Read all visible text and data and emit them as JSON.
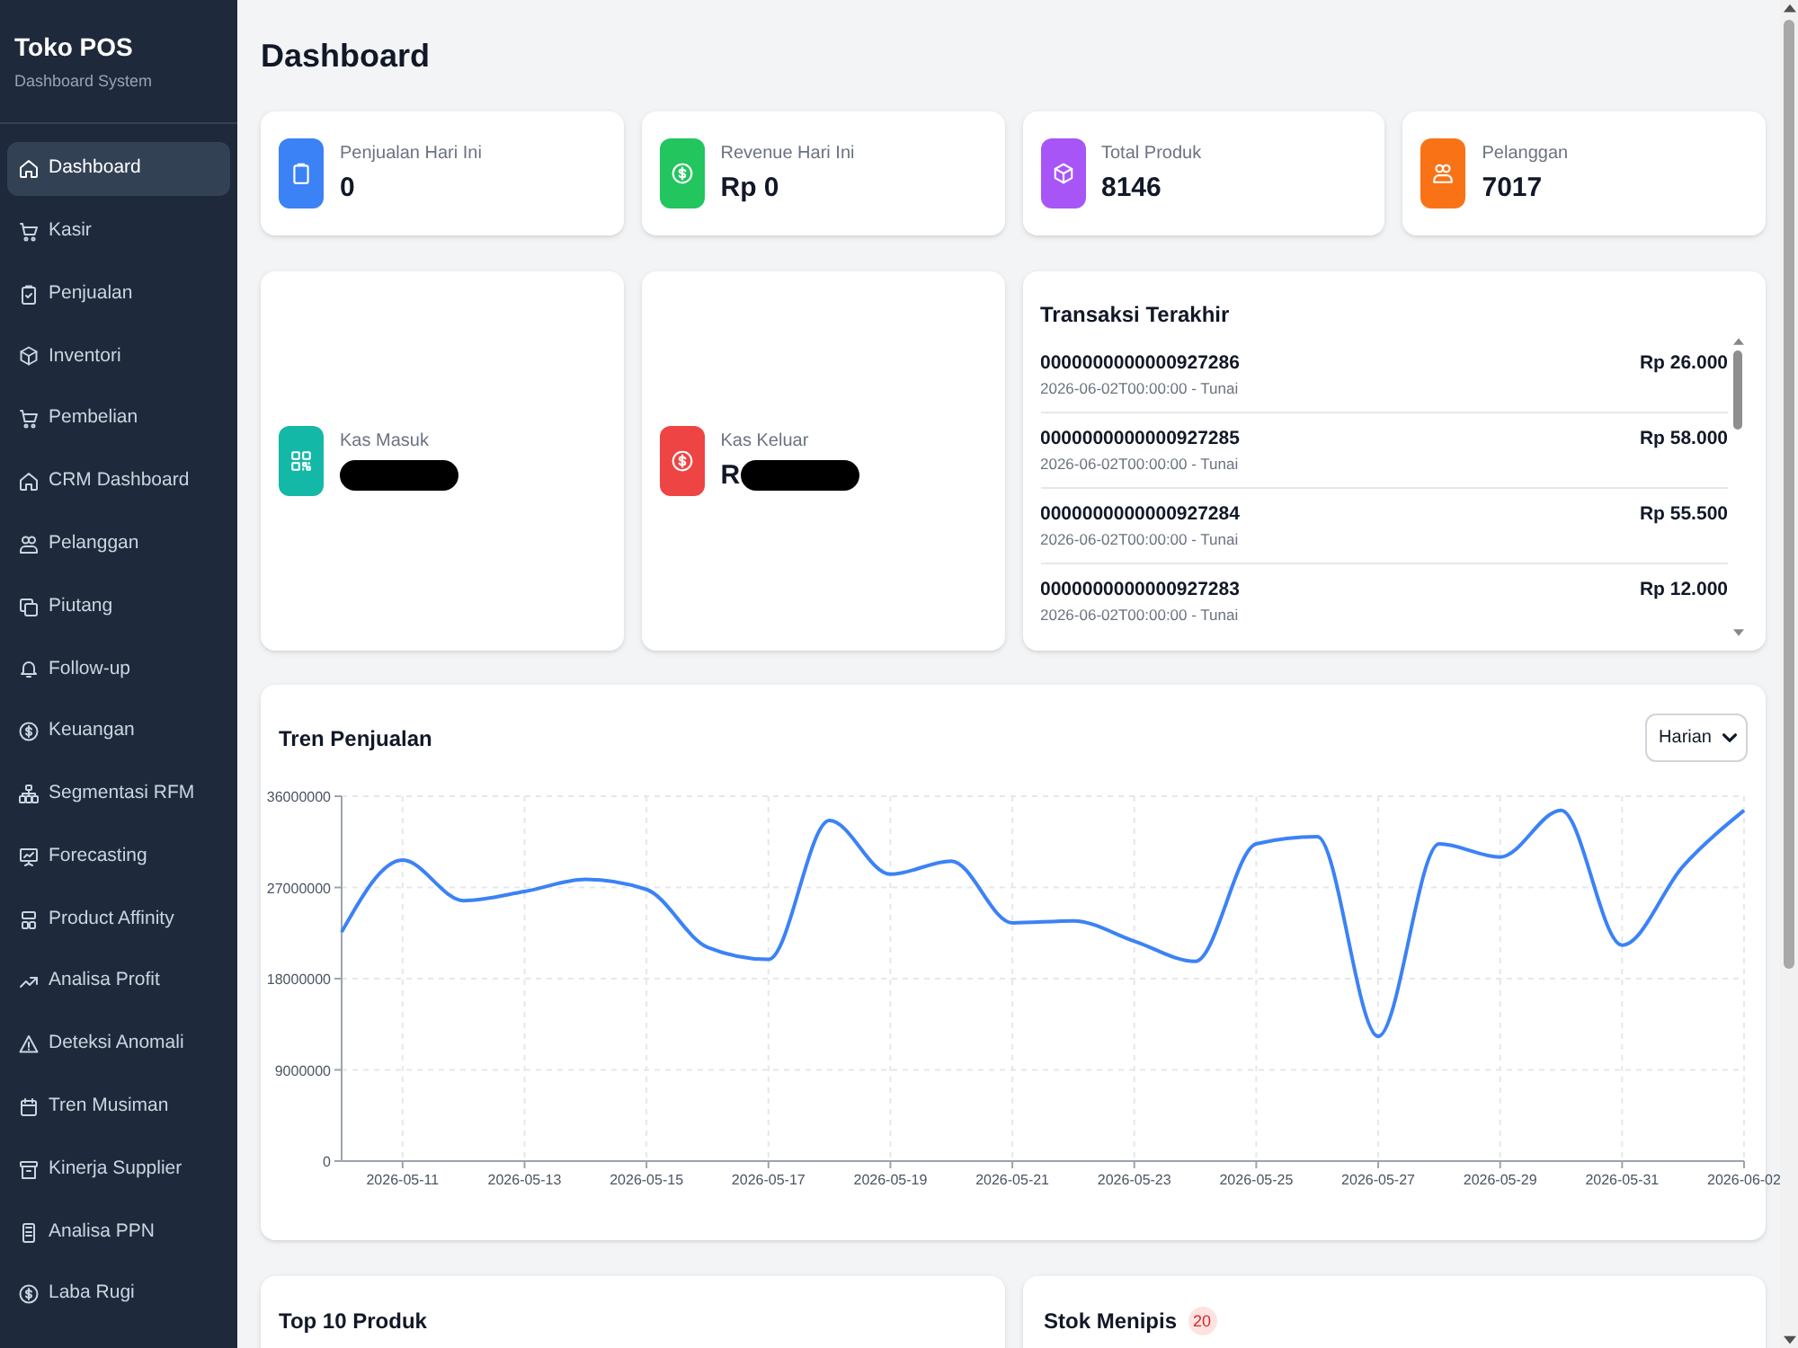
{
  "sidebar": {
    "brand": "Toko POS",
    "subtitle": "Dashboard System",
    "items": [
      {
        "label": "Dashboard",
        "selected": true
      },
      {
        "label": "Kasir",
        "selected": false
      },
      {
        "label": "Penjualan",
        "selected": false
      },
      {
        "label": "Inventori",
        "selected": false
      },
      {
        "label": "Pembelian",
        "selected": false
      },
      {
        "label": "CRM Dashboard",
        "selected": false
      },
      {
        "label": "Pelanggan",
        "selected": false
      },
      {
        "label": "Piutang",
        "selected": false
      },
      {
        "label": "Follow-up",
        "selected": false
      },
      {
        "label": "Keuangan",
        "selected": false
      },
      {
        "label": "Segmentasi RFM",
        "selected": false
      },
      {
        "label": "Forecasting",
        "selected": false
      },
      {
        "label": "Product Affinity",
        "selected": false
      },
      {
        "label": "Analisa Profit",
        "selected": false
      },
      {
        "label": "Deteksi Anomali",
        "selected": false
      },
      {
        "label": "Tren Musiman",
        "selected": false
      },
      {
        "label": "Kinerja Supplier",
        "selected": false
      },
      {
        "label": "Analisa PPN",
        "selected": false
      },
      {
        "label": "Laba Rugi",
        "selected": false
      }
    ]
  },
  "page_title": "Dashboard",
  "stats": [
    {
      "label": "Penjualan Hari Ini",
      "value": "0",
      "color": "#3b82f6"
    },
    {
      "label": "Revenue Hari Ini",
      "value": "Rp 0",
      "color": "#22c55e"
    },
    {
      "label": "Total Produk",
      "value": "8146",
      "color": "#a855f7"
    },
    {
      "label": "Pelanggan",
      "value": "7017",
      "color": "#f97316"
    }
  ],
  "cash": [
    {
      "label": "Kas Masuk",
      "redacted": true,
      "color": "#14b8a6"
    },
    {
      "label": "Kas Keluar",
      "value": "R",
      "redacted": true,
      "color": "#ef4444"
    }
  ],
  "recent_transactions": {
    "title": "Transaksi Terakhir",
    "rows": [
      {
        "id": "0000000000000927286",
        "meta": "2026-06-02T00:00:00 - Tunai",
        "amount": "Rp 26.000"
      },
      {
        "id": "0000000000000927285",
        "meta": "2026-06-02T00:00:00 - Tunai",
        "amount": "Rp 58.000"
      },
      {
        "id": "0000000000000927284",
        "meta": "2026-06-02T00:00:00 - Tunai",
        "amount": "Rp 55.500"
      },
      {
        "id": "0000000000000927283",
        "meta": "2026-06-02T00:00:00 - Tunai",
        "amount": "Rp 12.000"
      }
    ]
  },
  "sales_trend": {
    "title": "Tren Penjualan",
    "period": "Harian",
    "chart_data": [
      {
        "type": "line",
        "x": [
          "2026-05-10",
          "2026-05-11",
          "2026-05-12",
          "2026-05-13",
          "2026-05-14",
          "2026-05-15",
          "2026-05-16",
          "2026-05-17",
          "2026-05-18",
          "2026-05-19",
          "2026-05-20",
          "2026-05-21",
          "2026-05-22",
          "2026-05-23",
          "2026-05-24",
          "2026-05-25",
          "2026-05-26",
          "2026-05-27",
          "2026-05-28",
          "2026-05-29",
          "2026-05-30",
          "2026-05-31",
          "2026-06-01",
          "2026-06-02"
        ],
        "values": [
          22600000,
          29700000,
          25700000,
          26600000,
          27800000,
          26800000,
          21100000,
          19900000,
          33600000,
          28300000,
          29600000,
          23500000,
          23700000,
          21700000,
          19700000,
          31300000,
          32000000,
          12300000,
          31300000,
          30000000,
          34600000,
          21300000,
          29100000,
          34600000
        ],
        "color": "#3b82f6",
        "xlim": [
          "2026-05-10",
          "2026-06-02"
        ],
        "ylim": [
          0,
          36000000
        ],
        "yticks": [
          0,
          9000000,
          18000000,
          27000000,
          36000000
        ],
        "xticks": [
          "2026-05-11",
          "2026-05-13",
          "2026-05-15",
          "2026-05-17",
          "2026-05-19",
          "2026-05-21",
          "2026-05-23",
          "2026-05-25",
          "2026-05-27",
          "2026-05-29",
          "2026-05-31",
          "2026-06-02"
        ],
        "grid": true
      }
    ]
  },
  "top_products": {
    "title": "Top 10 Produk"
  },
  "low_stock": {
    "title": "Stok Menipis",
    "count": "20"
  }
}
